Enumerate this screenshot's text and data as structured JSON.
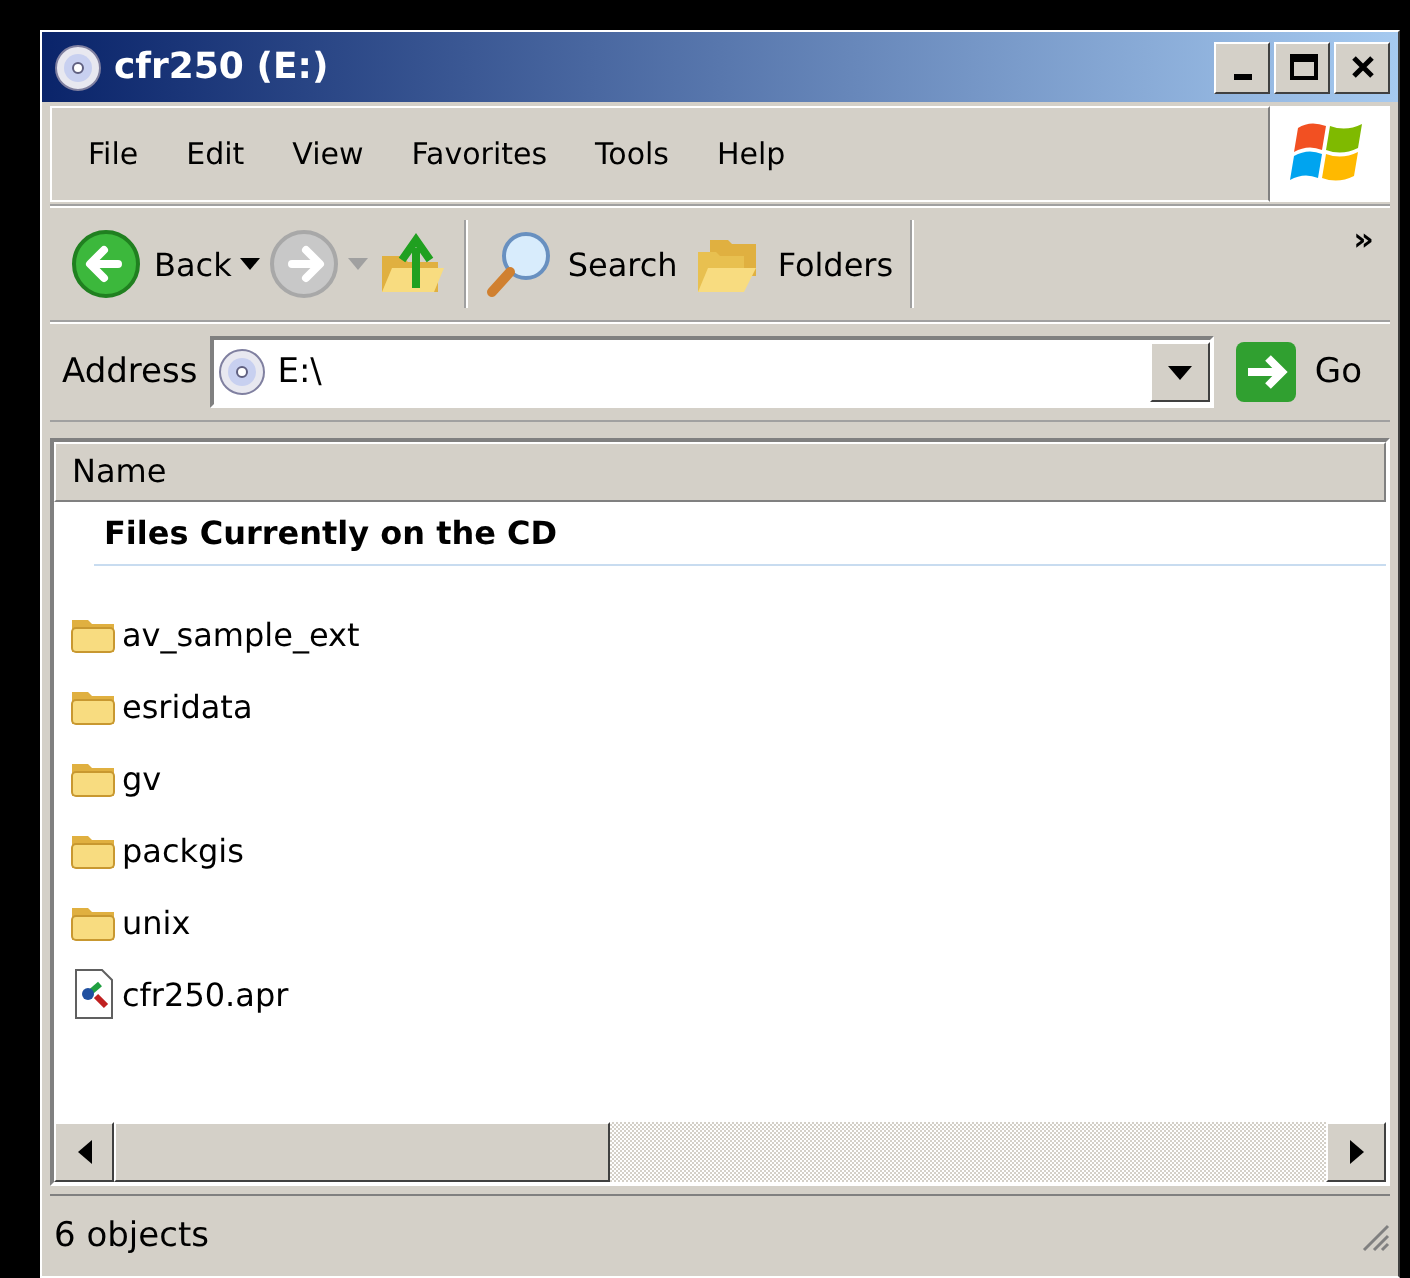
{
  "window": {
    "title": "cfr250 (E:)"
  },
  "menu": [
    "File",
    "Edit",
    "View",
    "Favorites",
    "Tools",
    "Help"
  ],
  "toolbar": [
    {
      "kind": "back",
      "label": "Back",
      "disabled": false
    },
    {
      "kind": "forward",
      "disabled": true
    },
    {
      "kind": "up",
      "disabled": false
    },
    {
      "kind": "search",
      "label": "Search",
      "disabled": false
    },
    {
      "kind": "folders",
      "label": "Folders",
      "disabled": false
    }
  ],
  "toolbar_more": "»",
  "address": {
    "label": "Address",
    "value": "E:\\",
    "go": "Go"
  },
  "columns": [
    "Name"
  ],
  "group": {
    "title": "Files Currently on the CD"
  },
  "items": [
    {
      "kind": "folder",
      "name": "av_sample_ext"
    },
    {
      "kind": "folder",
      "name": "esridata"
    },
    {
      "kind": "folder",
      "name": "gv"
    },
    {
      "kind": "folder",
      "name": "packgis"
    },
    {
      "kind": "folder",
      "name": "unix"
    },
    {
      "kind": "file",
      "name": "cfr250.apr"
    }
  ],
  "status_bar": "6 objects"
}
